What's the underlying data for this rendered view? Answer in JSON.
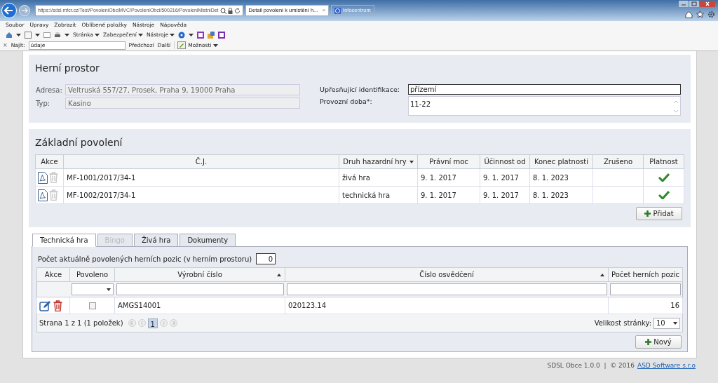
{
  "browser": {
    "address": "https://sdsl.mfcr.cz/Test/PovoleniObciMVC/PovoleniObci/500216/PovoleniMistniDet",
    "tabs": [
      {
        "label": "Detail povolení k umístění h...",
        "selected": true,
        "close": "×"
      },
      {
        "label": "Infocentrum",
        "selected": false
      }
    ],
    "menu": [
      "Soubor",
      "Úpravy",
      "Zobrazit",
      "Oblíbené položky",
      "Nástroje",
      "Nápověda"
    ],
    "toolbar": [
      "Stránka",
      "Zabezpečení",
      "Nástroje"
    ],
    "find": {
      "close": "×",
      "label": "Najít:",
      "value": "údaje",
      "buttons": [
        "Předchozí",
        "Další"
      ],
      "options": "Možnosti"
    }
  },
  "herni_prostor": {
    "title": "Herní prostor",
    "left_fields": [
      {
        "label": "Adresa:",
        "value": "Veltruská 557/27, Prosek, Praha 9, 19000 Praha",
        "disabled": true
      },
      {
        "label": "Typ:",
        "value": "Kasino",
        "disabled": true
      }
    ],
    "right_fields": [
      {
        "label": "Upřesňující identifikace:",
        "value": "přízemí",
        "kind": "input"
      },
      {
        "label": "Provozní doba*:",
        "value": "11-22",
        "kind": "textarea"
      }
    ]
  },
  "zakladni_povoleni": {
    "title": "Základní povolení",
    "columns": [
      {
        "label": "Akce"
      },
      {
        "label": "Č.J."
      },
      {
        "label": "Druh hazardní hry",
        "dropdown": true
      },
      {
        "label": "Právní moc"
      },
      {
        "label": "Účinnost od"
      },
      {
        "label": "Konec platnosti"
      },
      {
        "label": "Zrušeno"
      },
      {
        "label": "Platnost"
      }
    ],
    "rows": [
      {
        "cj": "MF-1001/2017/34-1",
        "druh": "živá hra",
        "pravni_moc": "9. 1. 2017",
        "ucinnost_od": "9. 1. 2017",
        "konec": "8. 1. 2023",
        "valid": true
      },
      {
        "cj": "MF-1002/2017/34-1",
        "druh": "technická hra",
        "pravni_moc": "9. 1. 2017",
        "ucinnost_od": "9. 1. 2017",
        "konec": "8. 1. 2023",
        "valid": true
      }
    ],
    "add_button": "Přidat"
  },
  "tabs": [
    {
      "label": "Technická hra",
      "selected": true,
      "disabled": false
    },
    {
      "label": "Bingo",
      "selected": false,
      "disabled": true
    },
    {
      "label": "Živá hra",
      "selected": false,
      "disabled": false
    },
    {
      "label": "Dokumenty",
      "selected": false,
      "disabled": false
    }
  ],
  "technicka_hra": {
    "count_label": "Počet aktuálně povolených herních pozic (v herním prostoru)",
    "count_value": "0",
    "columns": [
      {
        "label": "Akce",
        "kind": "plain"
      },
      {
        "label": "Povoleno",
        "kind": "select"
      },
      {
        "label": "Výrobní číslo",
        "kind": "text",
        "sorted": true
      },
      {
        "label": "Číslo osvědčení",
        "kind": "text",
        "sorted": true
      },
      {
        "label": "Počet herních pozic",
        "kind": "text"
      }
    ],
    "rows": [
      {
        "povoleno": false,
        "vyrobni_cislo": "AMGS14001",
        "cislo_osvedceni": "020123.14",
        "pocet": "16"
      }
    ],
    "pager": {
      "text": "Strana 1 z 1 (1 položek)",
      "pages": [
        {
          "label": "1",
          "selected": true
        }
      ],
      "size_label": "Velikost stránky:",
      "size": "10"
    },
    "new_button": "Nový"
  },
  "footer": {
    "text": "SDSL Obce 1.0.0  |  © 2016",
    "link": "ASD Software s.r.o"
  }
}
